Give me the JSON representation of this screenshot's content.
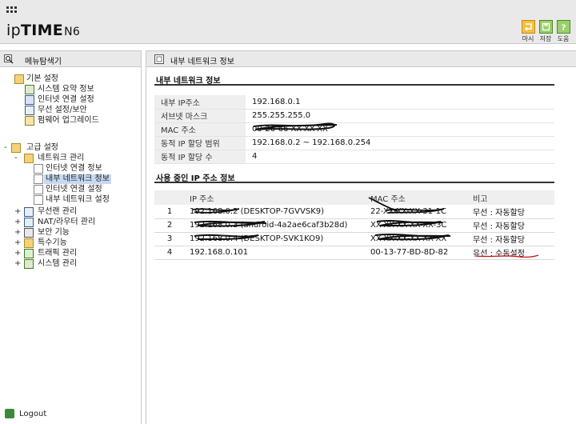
{
  "header": {
    "logo_part1": "ip",
    "logo_part2": "TIME",
    "logo_part3": "N6",
    "buttons": [
      {
        "label": "마시",
        "icon": "return-icon",
        "color": "#e8a020"
      },
      {
        "label": "저장",
        "icon": "save-icon",
        "color": "#5aa032"
      },
      {
        "label": "도움",
        "icon": "help-icon",
        "color": "#5aa032"
      }
    ]
  },
  "sidebar": {
    "title": "메뉴탐색기",
    "items": [
      {
        "label": "기본 설정",
        "icon": "settings-folder-icon",
        "expander": ""
      },
      {
        "label": "시스템 요약 정보",
        "icon": "chart-icon",
        "expander": ""
      },
      {
        "label": "인터넷 연결 설정",
        "icon": "network-icon",
        "expander": ""
      },
      {
        "label": "무선 설정/보안",
        "icon": "wireless-icon",
        "expander": ""
      },
      {
        "label": "펌웨어 업그레이드",
        "icon": "upgrade-icon",
        "expander": ""
      },
      {
        "label": "고급 설정",
        "icon": "settings-folder-icon",
        "expander": "-"
      },
      {
        "label": "네트워크 관리",
        "icon": "network-folder-icon",
        "expander": "-"
      },
      {
        "label": "인터넷 연결 정보",
        "icon": "page-icon",
        "expander": ""
      },
      {
        "label": "내부 네트워크 정보",
        "icon": "page-icon",
        "expander": ""
      },
      {
        "label": "인터넷 연결 설정",
        "icon": "page-icon",
        "expander": ""
      },
      {
        "label": "내부 네트워크 설정",
        "icon": "page-icon",
        "expander": ""
      },
      {
        "label": "무선랜 관리",
        "icon": "wireless-icon",
        "expander": "+"
      },
      {
        "label": "NAT/라우터 관리",
        "icon": "router-icon",
        "expander": "+"
      },
      {
        "label": "보안 기능",
        "icon": "lock-icon",
        "expander": "+"
      },
      {
        "label": "특수기능",
        "icon": "folder-icon",
        "expander": "+"
      },
      {
        "label": "트래픽 관리",
        "icon": "traffic-icon",
        "expander": "+"
      },
      {
        "label": "시스템 관리",
        "icon": "chart-icon",
        "expander": "+"
      }
    ],
    "selected_index": 8,
    "logout": "Logout"
  },
  "main": {
    "title": "내부 네트워크 정보",
    "section1_title": "내부 네트워크 정보",
    "info": [
      {
        "key": "내부 IP주소",
        "value": "192.168.0.1"
      },
      {
        "key": "서브넷 마스크",
        "value": "255.255.255.0"
      },
      {
        "key": "MAC 주소",
        "value": "00-26-66-XX-XX-XX"
      },
      {
        "key": "동적 IP 할당 범위",
        "value": "192.168.0.2 ~  192.168.0.254"
      },
      {
        "key": "동적 IP 할당 수",
        "value": "4"
      }
    ],
    "section2_title": "사용 중인 IP 주소 정보",
    "columns": [
      "IP 주소",
      "MAC 주소",
      "비고"
    ],
    "rows": [
      {
        "no": "1",
        "ip": "192.168.0.2 (DESKTOP-7GVVSK9)",
        "mac": "22-XX-XX-XX-31-1C",
        "note": "무선 : 자동할당"
      },
      {
        "no": "2",
        "ip": "192.168.0.3 (android-4a2ae6caf3b28d)",
        "mac": "XX-XX-XX-XX-XX-3C",
        "note": "무선 : 자동할당"
      },
      {
        "no": "3",
        "ip": "192.168.0.4 (DESKTOP-SVK1KO9)",
        "mac": "XX-XX-XX-XX-XX-XX",
        "note": "무선 : 자동할당"
      },
      {
        "no": "4",
        "ip": "192.168.0.101",
        "mac": "00-13-77-BD-8D-82",
        "note": "유선 : 수동설정"
      }
    ]
  }
}
